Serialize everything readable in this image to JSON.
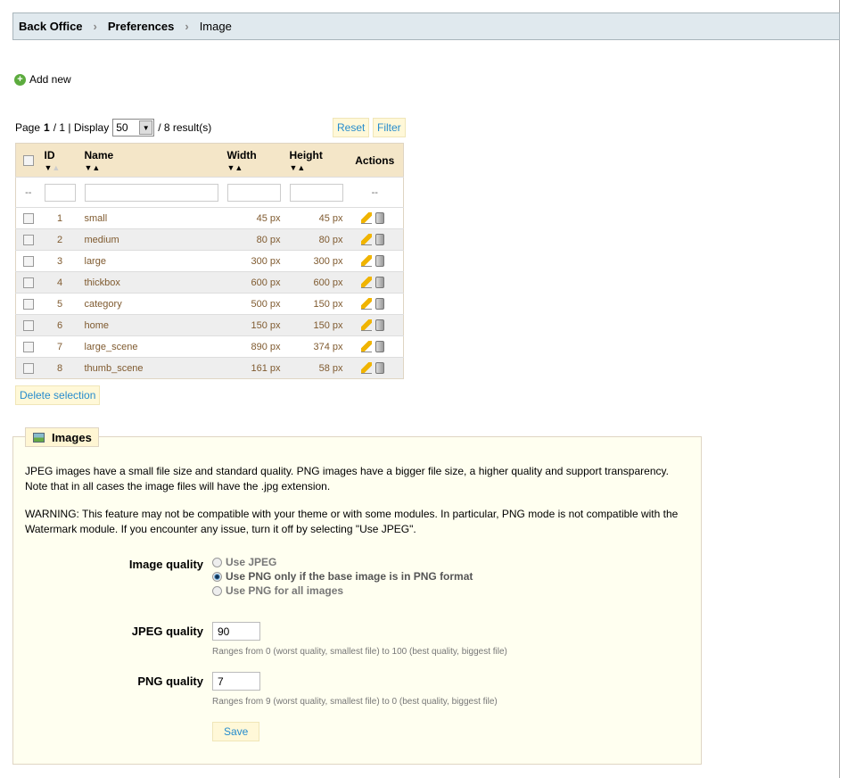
{
  "breadcrumb": {
    "items": [
      "Back Office",
      "Preferences",
      "Image"
    ]
  },
  "add_new": "Add new",
  "pager": {
    "page_label": "Page",
    "page": "1",
    "total": "/ 1 | Display",
    "display": "50",
    "results": "/ 8 result(s)"
  },
  "buttons": {
    "reset": "Reset",
    "filter": "Filter",
    "delete_selection": "Delete selection",
    "save": "Save"
  },
  "table": {
    "headers": {
      "id": "ID",
      "name": "Name",
      "width": "Width",
      "height": "Height",
      "actions": "Actions"
    },
    "filter_placeholder": "--",
    "rows": [
      {
        "id": "1",
        "name": "small",
        "width": "45 px",
        "height": "45 px"
      },
      {
        "id": "2",
        "name": "medium",
        "width": "80 px",
        "height": "80 px"
      },
      {
        "id": "3",
        "name": "large",
        "width": "300 px",
        "height": "300 px"
      },
      {
        "id": "4",
        "name": "thickbox",
        "width": "600 px",
        "height": "600 px"
      },
      {
        "id": "5",
        "name": "category",
        "width": "500 px",
        "height": "150 px"
      },
      {
        "id": "6",
        "name": "home",
        "width": "150 px",
        "height": "150 px"
      },
      {
        "id": "7",
        "name": "large_scene",
        "width": "890 px",
        "height": "374 px"
      },
      {
        "id": "8",
        "name": "thumb_scene",
        "width": "161 px",
        "height": "58 px"
      }
    ]
  },
  "images": {
    "legend": "Images",
    "para1": "JPEG images have a small file size and standard quality. PNG images have a bigger file size, a higher quality and support transparency. Note that in all cases the image files will have the .jpg extension.",
    "para2": "WARNING: This feature may not be compatible with your theme or with some modules. In particular, PNG mode is not compatible with the Watermark module. If you encounter any issue, turn it off by selecting \"Use JPEG\".",
    "image_quality_label": "Image quality",
    "options": [
      "Use JPEG",
      "Use PNG only if the base image is in PNG format",
      "Use PNG for all images"
    ],
    "selected_option": 1,
    "jpeg_label": "JPEG quality",
    "jpeg_value": "90",
    "jpeg_hint": "Ranges from 0 (worst quality, smallest file) to 100 (best quality, biggest file)",
    "png_label": "PNG quality",
    "png_value": "7",
    "png_hint": "Ranges from 9 (worst quality, smallest file) to 0 (best quality, biggest file)"
  }
}
